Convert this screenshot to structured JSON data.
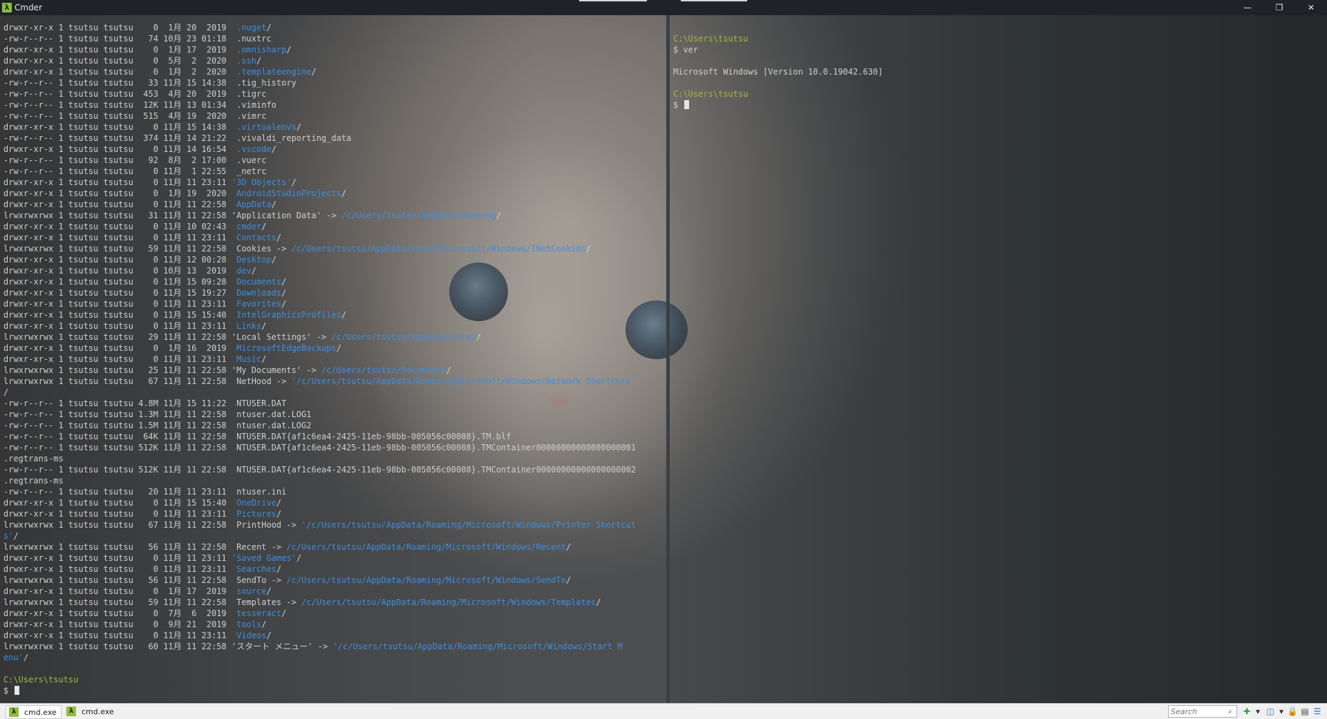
{
  "window": {
    "title": "Cmder"
  },
  "window_controls": {
    "minimize": "—",
    "restore": "❐",
    "close": "✕"
  },
  "left_pane": {
    "lines": [
      [
        {
          "t": "drwxr-xr-x 1 tsutsu tsutsu    0  1月 20  2019  "
        },
        {
          "t": ".nuget",
          "c": "dir"
        },
        {
          "t": "/"
        }
      ],
      [
        {
          "t": "-rw-r--r-- 1 tsutsu tsutsu   74 10月 23 01:18  .nuxtrc"
        }
      ],
      [
        {
          "t": "drwxr-xr-x 1 tsutsu tsutsu    0  1月 17  2019  "
        },
        {
          "t": ".omnisharp",
          "c": "dir"
        },
        {
          "t": "/"
        }
      ],
      [
        {
          "t": "drwxr-xr-x 1 tsutsu tsutsu    0  5月  2  2020  "
        },
        {
          "t": ".ssh",
          "c": "dir"
        },
        {
          "t": "/"
        }
      ],
      [
        {
          "t": "drwxr-xr-x 1 tsutsu tsutsu    0  1月  2  2020  "
        },
        {
          "t": ".templateengine",
          "c": "dir"
        },
        {
          "t": "/"
        }
      ],
      [
        {
          "t": "-rw-r--r-- 1 tsutsu tsutsu   33 11月 15 14:38  .tig_history"
        }
      ],
      [
        {
          "t": "-rw-r--r-- 1 tsutsu tsutsu  453  4月 20  2019  .tigrc"
        }
      ],
      [
        {
          "t": "-rw-r--r-- 1 tsutsu tsutsu  12K 11月 13 01:34  .viminfo"
        }
      ],
      [
        {
          "t": "-rw-r--r-- 1 tsutsu tsutsu  515  4月 19  2020  .vimrc"
        }
      ],
      [
        {
          "t": "drwxr-xr-x 1 tsutsu tsutsu    0 11月 15 14:38  "
        },
        {
          "t": ".virtualenvs",
          "c": "dir"
        },
        {
          "t": "/"
        }
      ],
      [
        {
          "t": "-rw-r--r-- 1 tsutsu tsutsu  374 11月 14 21:22  .vivaldi_reporting_data"
        }
      ],
      [
        {
          "t": "drwxr-xr-x 1 tsutsu tsutsu    0 11月 14 16:54  "
        },
        {
          "t": ".vscode",
          "c": "dir"
        },
        {
          "t": "/"
        }
      ],
      [
        {
          "t": "-rw-r--r-- 1 tsutsu tsutsu   92  8月  2 17:00  .vuerc"
        }
      ],
      [
        {
          "t": "-rw-r--r-- 1 tsutsu tsutsu    0 11月  1 22:55  _netrc"
        }
      ],
      [
        {
          "t": "drwxr-xr-x 1 tsutsu tsutsu    0 11月 11 23:11 "
        },
        {
          "t": "'3D Objects'",
          "c": "dir"
        },
        {
          "t": "/"
        }
      ],
      [
        {
          "t": "drwxr-xr-x 1 tsutsu tsutsu    0  1月 19  2020  "
        },
        {
          "t": "AndroidStudioProjects",
          "c": "dir"
        },
        {
          "t": "/"
        }
      ],
      [
        {
          "t": "drwxr-xr-x 1 tsutsu tsutsu    0 11月 11 22:58  "
        },
        {
          "t": "AppData",
          "c": "dir"
        },
        {
          "t": "/"
        }
      ],
      [
        {
          "t": "lrwxrwxrwx 1 tsutsu tsutsu   31 11月 11 22:58 'Application Data' -> "
        },
        {
          "t": "/c/Users/tsutsu/AppData/Roaming",
          "c": "link"
        },
        {
          "t": "/"
        }
      ],
      [
        {
          "t": "drwxr-xr-x 1 tsutsu tsutsu    0 11月 10 02:43  "
        },
        {
          "t": "cmder",
          "c": "dir"
        },
        {
          "t": "/"
        }
      ],
      [
        {
          "t": "drwxr-xr-x 1 tsutsu tsutsu    0 11月 11 23:11  "
        },
        {
          "t": "Contacts",
          "c": "dir"
        },
        {
          "t": "/"
        }
      ],
      [
        {
          "t": "lrwxrwxrwx 1 tsutsu tsutsu   59 11月 11 22:58  Cookies -> "
        },
        {
          "t": "/c/Users/tsutsu/AppData/Local/Microsoft/Windows/INetCookies",
          "c": "link"
        },
        {
          "t": "/"
        }
      ],
      [
        {
          "t": "drwxr-xr-x 1 tsutsu tsutsu    0 11月 12 00:28  "
        },
        {
          "t": "Desktop",
          "c": "dir"
        },
        {
          "t": "/"
        }
      ],
      [
        {
          "t": "drwxr-xr-x 1 tsutsu tsutsu    0 10月 13  2019  "
        },
        {
          "t": "dev",
          "c": "dir"
        },
        {
          "t": "/"
        }
      ],
      [
        {
          "t": "drwxr-xr-x 1 tsutsu tsutsu    0 11月 15 09:28  "
        },
        {
          "t": "Documents",
          "c": "dir"
        },
        {
          "t": "/"
        }
      ],
      [
        {
          "t": "drwxr-xr-x 1 tsutsu tsutsu    0 11月 15 19:27  "
        },
        {
          "t": "Downloads",
          "c": "dir"
        },
        {
          "t": "/"
        }
      ],
      [
        {
          "t": "drwxr-xr-x 1 tsutsu tsutsu    0 11月 11 23:11  "
        },
        {
          "t": "Favorites",
          "c": "dir"
        },
        {
          "t": "/"
        }
      ],
      [
        {
          "t": "drwxr-xr-x 1 tsutsu tsutsu    0 11月 15 15:40  "
        },
        {
          "t": "IntelGraphicsProfiles",
          "c": "dir"
        },
        {
          "t": "/"
        }
      ],
      [
        {
          "t": "drwxr-xr-x 1 tsutsu tsutsu    0 11月 11 23:11  "
        },
        {
          "t": "Links",
          "c": "dir"
        },
        {
          "t": "/"
        }
      ],
      [
        {
          "t": "lrwxrwxrwx 1 tsutsu tsutsu   29 11月 11 22:58 'Local Settings' -> "
        },
        {
          "t": "/c/Users/tsutsu/AppData/Local",
          "c": "link"
        },
        {
          "t": "/"
        }
      ],
      [
        {
          "t": "drwxr-xr-x 1 tsutsu tsutsu    0  1月 16  2019  "
        },
        {
          "t": "MicrosoftEdgeBackups",
          "c": "dir"
        },
        {
          "t": "/"
        }
      ],
      [
        {
          "t": "drwxr-xr-x 1 tsutsu tsutsu    0 11月 11 23:11  "
        },
        {
          "t": "Music",
          "c": "dir"
        },
        {
          "t": "/"
        }
      ],
      [
        {
          "t": "lrwxrwxrwx 1 tsutsu tsutsu   25 11月 11 22:58 'My Documents' -> "
        },
        {
          "t": "/c/Users/tsutsu/Documents",
          "c": "link"
        },
        {
          "t": "/"
        }
      ],
      [
        {
          "t": "lrwxrwxrwx 1 tsutsu tsutsu   67 11月 11 22:58  NetHood -> "
        },
        {
          "t": "'/c/Users/tsutsu/AppData/Roaming/Microsoft/Windows/Network Shortcuts'",
          "c": "link"
        }
      ],
      [
        {
          "t": "/"
        }
      ],
      [
        {
          "t": "-rw-r--r-- 1 tsutsu tsutsu 4.8M 11月 15 11:22  NTUSER.DAT"
        }
      ],
      [
        {
          "t": "-rw-r--r-- 1 tsutsu tsutsu 1.3M 11月 11 22:58  ntuser.dat.LOG1"
        }
      ],
      [
        {
          "t": "-rw-r--r-- 1 tsutsu tsutsu 1.5M 11月 11 22:58  ntuser.dat.LOG2"
        }
      ],
      [
        {
          "t": "-rw-r--r-- 1 tsutsu tsutsu  64K 11月 11 22:58  NTUSER.DAT{af1c6ea4-2425-11eb-98bb-005056c00008}.TM.blf"
        }
      ],
      [
        {
          "t": "-rw-r--r-- 1 tsutsu tsutsu 512K 11月 11 22:58  NTUSER.DAT{af1c6ea4-2425-11eb-98bb-005056c00008}.TMContainer00000000000000000001"
        }
      ],
      [
        {
          "t": ".regtrans-ms"
        }
      ],
      [
        {
          "t": "-rw-r--r-- 1 tsutsu tsutsu 512K 11月 11 22:58  NTUSER.DAT{af1c6ea4-2425-11eb-98bb-005056c00008}.TMContainer00000000000000000002"
        }
      ],
      [
        {
          "t": ".regtrans-ms"
        }
      ],
      [
        {
          "t": "-rw-r--r-- 1 tsutsu tsutsu   20 11月 11 23:11  ntuser.ini"
        }
      ],
      [
        {
          "t": "drwxr-xr-x 1 tsutsu tsutsu    0 11月 15 15:40  "
        },
        {
          "t": "OneDrive",
          "c": "dir"
        },
        {
          "t": "/"
        }
      ],
      [
        {
          "t": "drwxr-xr-x 1 tsutsu tsutsu    0 11月 11 23:11  "
        },
        {
          "t": "Pictures",
          "c": "dir"
        },
        {
          "t": "/"
        }
      ],
      [
        {
          "t": "lrwxrwxrwx 1 tsutsu tsutsu   67 11月 11 22:58  PrintHood -> "
        },
        {
          "t": "'/c/Users/tsutsu/AppData/Roaming/Microsoft/Windows/Printer Shortcut",
          "c": "link"
        }
      ],
      [
        {
          "t": "s'",
          "c": "link"
        },
        {
          "t": "/"
        }
      ],
      [
        {
          "t": "lrwxrwxrwx 1 tsutsu tsutsu   56 11月 11 22:58  Recent -> "
        },
        {
          "t": "/c/Users/tsutsu/AppData/Roaming/Microsoft/Windows/Recent",
          "c": "link"
        },
        {
          "t": "/"
        }
      ],
      [
        {
          "t": "drwxr-xr-x 1 tsutsu tsutsu    0 11月 11 23:11 "
        },
        {
          "t": "'Saved Games'",
          "c": "dir"
        },
        {
          "t": "/"
        }
      ],
      [
        {
          "t": "drwxr-xr-x 1 tsutsu tsutsu    0 11月 11 23:11  "
        },
        {
          "t": "Searches",
          "c": "dir"
        },
        {
          "t": "/"
        }
      ],
      [
        {
          "t": "lrwxrwxrwx 1 tsutsu tsutsu   56 11月 11 22:58  SendTo -> "
        },
        {
          "t": "/c/Users/tsutsu/AppData/Roaming/Microsoft/Windows/SendTo",
          "c": "link"
        },
        {
          "t": "/"
        }
      ],
      [
        {
          "t": "drwxr-xr-x 1 tsutsu tsutsu    0  1月 17  2019  "
        },
        {
          "t": "source",
          "c": "dir"
        },
        {
          "t": "/"
        }
      ],
      [
        {
          "t": "lrwxrwxrwx 1 tsutsu tsutsu   59 11月 11 22:58  Templates -> "
        },
        {
          "t": "/c/Users/tsutsu/AppData/Roaming/Microsoft/Windows/Templates",
          "c": "link"
        },
        {
          "t": "/"
        }
      ],
      [
        {
          "t": "drwxr-xr-x 1 tsutsu tsutsu    0  7月  6  2019  "
        },
        {
          "t": "tesseract",
          "c": "dir"
        },
        {
          "t": "/"
        }
      ],
      [
        {
          "t": "drwxr-xr-x 1 tsutsu tsutsu    0  9月 21  2019  "
        },
        {
          "t": "tools",
          "c": "dir"
        },
        {
          "t": "/"
        }
      ],
      [
        {
          "t": "drwxr-xr-x 1 tsutsu tsutsu    0 11月 11 23:11  "
        },
        {
          "t": "Videos",
          "c": "dir"
        },
        {
          "t": "/"
        }
      ],
      [
        {
          "t": "lrwxrwxrwx 1 tsutsu tsutsu   60 11月 11 22:58 'スタート メニュー' -> "
        },
        {
          "t": "'/c/Users/tsutsu/AppData/Roaming/Microsoft/Windows/Start M",
          "c": "link"
        }
      ],
      [
        {
          "t": "enu'",
          "c": "link"
        },
        {
          "t": "/"
        }
      ],
      [
        {
          "t": ""
        }
      ],
      [
        {
          "t": "C:\\Users\\tsutsu",
          "c": "prompt"
        }
      ],
      [
        {
          "t": "$ "
        },
        {
          "cursor": true
        }
      ]
    ]
  },
  "right_pane": {
    "lines": [
      [
        {
          "t": ""
        }
      ],
      [
        {
          "t": "C:\\Users\\tsutsu",
          "c": "prompt"
        }
      ],
      [
        {
          "t": "$ ver"
        }
      ],
      [
        {
          "t": ""
        }
      ],
      [
        {
          "t": "Microsoft Windows [Version 10.0.19042.630]"
        }
      ],
      [
        {
          "t": ""
        }
      ],
      [
        {
          "t": "C:\\Users\\tsutsu",
          "c": "prompt"
        }
      ],
      [
        {
          "t": "$ "
        },
        {
          "cursor": true
        }
      ]
    ]
  },
  "statusbar": {
    "tabs": [
      {
        "label": "cmd.exe",
        "active": true
      },
      {
        "label": "cmd.exe",
        "active": false
      }
    ],
    "search_placeholder": "Search",
    "search_icon": "⌕",
    "buttons": [
      {
        "name": "new-console-icon",
        "glyph": "✚",
        "color": "#2ea043"
      },
      {
        "name": "new-console-dropdown-icon",
        "glyph": "▾",
        "color": "#333333"
      },
      {
        "name": "split-view-icon",
        "glyph": "◫",
        "color": "#2f6fb5"
      },
      {
        "name": "view-dropdown-icon",
        "glyph": "▾",
        "color": "#333333"
      },
      {
        "name": "lock-icon",
        "glyph": "🔒",
        "color": "#c9a100"
      },
      {
        "name": "window-icon",
        "glyph": "▤",
        "color": "#444444"
      },
      {
        "name": "menu-icon",
        "glyph": "☰",
        "color": "#2f6fb5"
      }
    ]
  },
  "colors": {
    "directory": "#3d8fe0",
    "prompt": "#a3b83a",
    "text": "#cfcfcf"
  }
}
